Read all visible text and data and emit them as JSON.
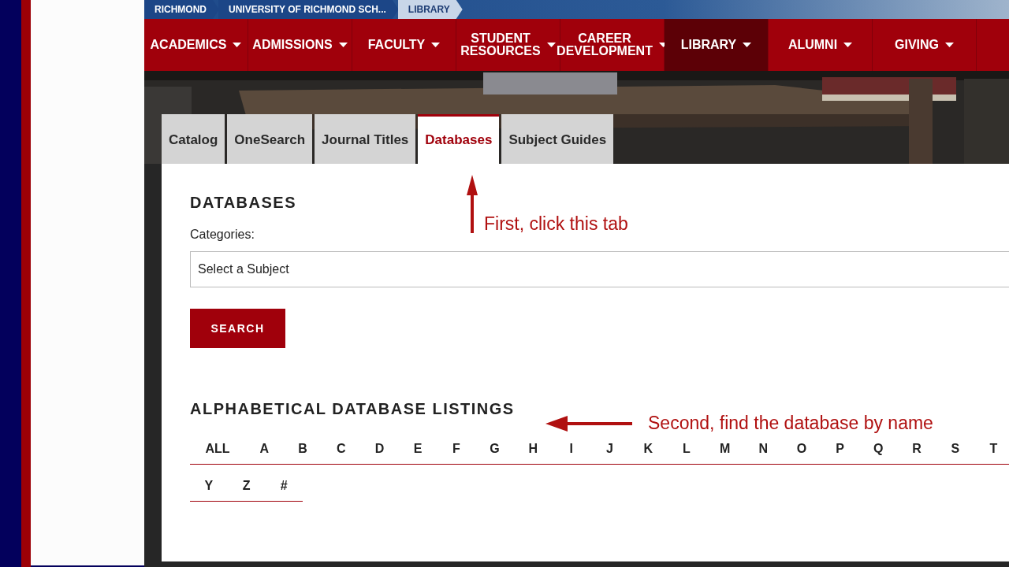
{
  "breadcrumbs": [
    {
      "label": "RICHMOND",
      "selected": false
    },
    {
      "label": "UNIVERSITY OF RICHMOND SCH...",
      "selected": false
    },
    {
      "label": "LIBRARY",
      "selected": true
    }
  ],
  "nav": [
    {
      "label": "ACADEMICS",
      "selected": false
    },
    {
      "label": "ADMISSIONS",
      "selected": false
    },
    {
      "label": "FACULTY",
      "selected": false
    },
    {
      "label": "STUDENT RESOURCES",
      "selected": false
    },
    {
      "label": "CAREER DEVELOPMENT",
      "selected": false
    },
    {
      "label": "LIBRARY",
      "selected": true
    },
    {
      "label": "ALUMNI",
      "selected": false
    },
    {
      "label": "GIVING",
      "selected": false
    }
  ],
  "tabs": [
    {
      "label": "Catalog",
      "selected": false
    },
    {
      "label": "OneSearch",
      "selected": false
    },
    {
      "label": "Journal Titles",
      "selected": false
    },
    {
      "label": "Databases",
      "selected": true
    },
    {
      "label": "Subject Guides",
      "selected": false
    }
  ],
  "databases": {
    "heading": "DATABASES",
    "categories_label": "Categories:",
    "subject_select": {
      "value": "Select a Subject"
    },
    "search_button": "SEARCH"
  },
  "listings": {
    "heading": "ALPHABETICAL DATABASE LISTINGS",
    "rows": [
      [
        "ALL",
        "A",
        "B",
        "C",
        "D",
        "E",
        "F",
        "G",
        "H",
        "I",
        "J",
        "K",
        "L",
        "M",
        "N",
        "O",
        "P",
        "Q",
        "R",
        "S",
        "T"
      ],
      [
        "Y",
        "Z",
        "#"
      ]
    ]
  },
  "annotations": [
    {
      "kind": "up",
      "text": "First, click this tab"
    },
    {
      "kind": "left",
      "text": "Second, find the database by name"
    }
  ]
}
